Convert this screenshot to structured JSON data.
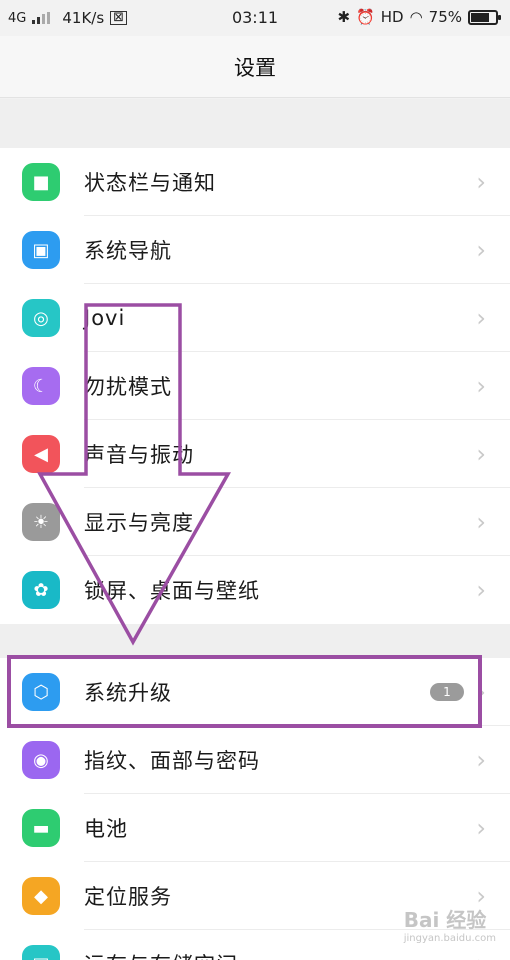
{
  "status_bar": {
    "network": "4G",
    "speed": "41K/s",
    "time": "03:11",
    "hd": "HD",
    "battery_text": "75%",
    "battery_level": 0.75
  },
  "header": {
    "title": "设置"
  },
  "groups": [
    {
      "items": [
        {
          "label": "状态栏与通知",
          "icon": "notification-icon",
          "color": "#2ecc71",
          "glyph": "■"
        },
        {
          "label": "系统导航",
          "icon": "navigation-icon",
          "color": "#2d9cf0",
          "glyph": "▣"
        },
        {
          "label": "Jovi",
          "icon": "jovi-icon",
          "color": "#26c6c6",
          "glyph": "◎"
        },
        {
          "label": "勿扰模式",
          "icon": "moon-icon",
          "color": "#a66cf0",
          "glyph": "☾"
        },
        {
          "label": "声音与振动",
          "icon": "speaker-icon",
          "color": "#f2545b",
          "glyph": "◀"
        },
        {
          "label": "显示与亮度",
          "icon": "brightness-icon",
          "color": "#9a9a9a",
          "glyph": "☀"
        },
        {
          "label": "锁屏、桌面与壁纸",
          "icon": "palette-icon",
          "color": "#19b9c7",
          "glyph": "✿"
        }
      ]
    },
    {
      "items": [
        {
          "label": "系统升级",
          "icon": "system-update-icon",
          "color": "#2d9cf0",
          "glyph": "⬡",
          "badge": "1"
        },
        {
          "label": "指纹、面部与密码",
          "icon": "fingerprint-icon",
          "color": "#9b67f0",
          "glyph": "◉"
        },
        {
          "label": "电池",
          "icon": "battery-icon",
          "color": "#2ecc71",
          "glyph": "▬"
        },
        {
          "label": "定位服务",
          "icon": "location-icon",
          "color": "#f5a623",
          "glyph": "◆"
        },
        {
          "label": "运存与存储空间",
          "icon": "storage-icon",
          "color": "#26c6c6",
          "glyph": "▤"
        }
      ]
    }
  ],
  "chevron": "›",
  "annotation": {
    "color": "#9b4ea3"
  },
  "watermark": {
    "brand": "Bai 经验",
    "sub": "jingyan.baidu.com"
  }
}
